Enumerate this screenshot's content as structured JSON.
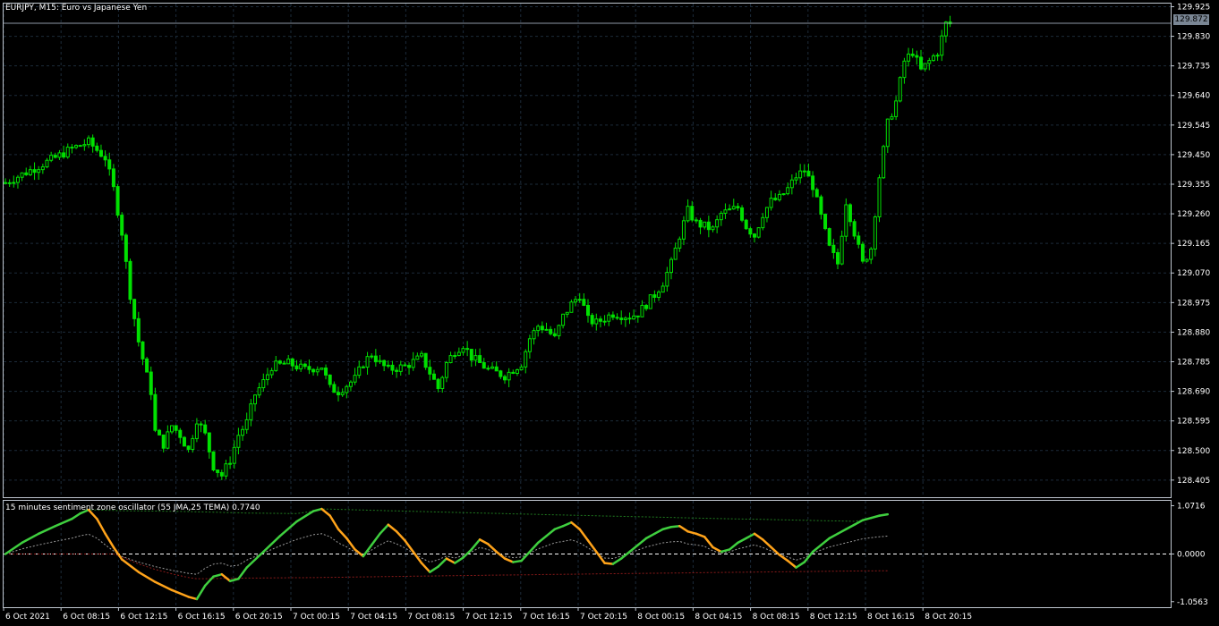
{
  "main_title": "EURJPY, M15:  Euro vs Japanese Yen",
  "osc_title": "15 minutes sentiment zone oscillator (55 JMA,25 TEMA) 0.7740",
  "current_price": "129.872",
  "colors": {
    "background": "#000000",
    "grid": "#1c2b3a",
    "candle": "#00e000",
    "osc_up": "#3fcf3f",
    "osc_down": "#ffa31a",
    "zone_top": "#1f7a1f",
    "zone_bottom": "#8b1a1a",
    "mid_gray": "#9a9a9a"
  },
  "chart_data": [
    {
      "type": "candlestick",
      "title": "EURJPY, M15:  Euro vs Japanese Yen",
      "x_ticks": [
        "6 Oct 2021",
        "6 Oct 08:15",
        "6 Oct 12:15",
        "6 Oct 16:15",
        "6 Oct 20:15",
        "7 Oct 00:15",
        "7 Oct 04:15",
        "7 Oct 08:15",
        "7 Oct 12:15",
        "7 Oct 16:15",
        "7 Oct 20:15",
        "8 Oct 00:15",
        "8 Oct 04:15",
        "8 Oct 08:15",
        "8 Oct 12:15",
        "8 Oct 16:15",
        "8 Oct 20:15"
      ],
      "y_ticks": [
        "129.925",
        "129.830",
        "129.735",
        "129.640",
        "129.545",
        "129.450",
        "129.355",
        "129.260",
        "129.165",
        "129.070",
        "128.975",
        "128.880",
        "128.785",
        "128.690",
        "128.595",
        "128.500",
        "128.405"
      ],
      "ylim": [
        128.35,
        129.935
      ],
      "current_price": 129.872,
      "close_path": [
        [
          0,
          129.36
        ],
        [
          6,
          129.4
        ],
        [
          12,
          129.44
        ],
        [
          16,
          129.47
        ],
        [
          20,
          129.49
        ],
        [
          24,
          129.44
        ],
        [
          26,
          129.34
        ],
        [
          28,
          129.2
        ],
        [
          30,
          129.0
        ],
        [
          32,
          128.85
        ],
        [
          34,
          128.74
        ],
        [
          35,
          128.69
        ],
        [
          36,
          128.56
        ],
        [
          38,
          128.52
        ],
        [
          40,
          128.58
        ],
        [
          42,
          128.55
        ],
        [
          44,
          128.5
        ],
        [
          46,
          128.6
        ],
        [
          48,
          128.55
        ],
        [
          50,
          128.45
        ],
        [
          52,
          128.42
        ],
        [
          54,
          128.47
        ],
        [
          56,
          128.55
        ],
        [
          58,
          128.59
        ],
        [
          60,
          128.68
        ],
        [
          62,
          128.72
        ],
        [
          64,
          128.77
        ],
        [
          68,
          128.78
        ],
        [
          72,
          128.76
        ],
        [
          76,
          128.77
        ],
        [
          78,
          128.7
        ],
        [
          80,
          128.69
        ],
        [
          84,
          128.73
        ],
        [
          86,
          128.78
        ],
        [
          88,
          128.81
        ],
        [
          90,
          128.78
        ],
        [
          92,
          128.76
        ],
        [
          96,
          128.77
        ],
        [
          100,
          128.8
        ],
        [
          102,
          128.75
        ],
        [
          104,
          128.7
        ],
        [
          106,
          128.78
        ],
        [
          108,
          128.82
        ],
        [
          110,
          128.84
        ],
        [
          112,
          128.8
        ],
        [
          116,
          128.76
        ],
        [
          120,
          128.74
        ],
        [
          124,
          128.78
        ],
        [
          126,
          128.86
        ],
        [
          128,
          128.9
        ],
        [
          130,
          128.89
        ],
        [
          132,
          128.86
        ],
        [
          134,
          128.93
        ],
        [
          136,
          128.97
        ],
        [
          138,
          129.0
        ],
        [
          140,
          128.92
        ],
        [
          142,
          128.91
        ],
        [
          146,
          128.94
        ],
        [
          150,
          128.93
        ],
        [
          152,
          128.94
        ],
        [
          156,
          129.0
        ],
        [
          158,
          129.04
        ],
        [
          160,
          129.1
        ],
        [
          162,
          129.19
        ],
        [
          164,
          129.27
        ],
        [
          166,
          129.23
        ],
        [
          168,
          129.22
        ],
        [
          170,
          129.21
        ],
        [
          172,
          129.26
        ],
        [
          176,
          129.28
        ],
        [
          178,
          129.22
        ],
        [
          180,
          129.19
        ],
        [
          182,
          129.26
        ],
        [
          184,
          129.3
        ],
        [
          186,
          129.31
        ],
        [
          188,
          129.34
        ],
        [
          190,
          129.38
        ],
        [
          192,
          129.4
        ],
        [
          194,
          129.35
        ],
        [
          196,
          129.25
        ],
        [
          198,
          129.15
        ],
        [
          200,
          129.1
        ],
        [
          202,
          129.3
        ],
        [
          204,
          129.2
        ],
        [
          206,
          129.1
        ],
        [
          208,
          129.15
        ],
        [
          210,
          129.38
        ],
        [
          212,
          129.55
        ],
        [
          214,
          129.62
        ],
        [
          216,
          129.75
        ],
        [
          218,
          129.78
        ],
        [
          220,
          129.72
        ],
        [
          222,
          129.75
        ],
        [
          224,
          129.78
        ],
        [
          226,
          129.87
        ],
        [
          227,
          129.87
        ]
      ]
    },
    {
      "type": "line",
      "title": "15 minutes sentiment zone oscillator (55 JMA,25 TEMA) 0.7740",
      "y_ticks": [
        "1.0716",
        "0.0000",
        "-1.0563"
      ],
      "ylim": [
        -1.18,
        1.18
      ],
      "level_line": 0.0,
      "series": [
        {
          "values": [
            [
              0,
              0.0
            ],
            [
              4,
              0.25
            ],
            [
              8,
              0.45
            ],
            [
              12,
              0.62
            ],
            [
              16,
              0.78
            ],
            [
              18,
              0.9
            ],
            [
              20,
              0.98
            ],
            [
              22,
              0.78
            ],
            [
              24,
              0.45
            ],
            [
              26,
              0.15
            ],
            [
              28,
              -0.12
            ],
            [
              32,
              -0.4
            ],
            [
              36,
              -0.62
            ],
            [
              40,
              -0.8
            ],
            [
              44,
              -0.95
            ],
            [
              46,
              -1.0
            ],
            [
              48,
              -0.7
            ],
            [
              50,
              -0.5
            ],
            [
              52,
              -0.45
            ],
            [
              54,
              -0.6
            ],
            [
              56,
              -0.55
            ],
            [
              58,
              -0.3
            ],
            [
              62,
              0.05
            ],
            [
              66,
              0.4
            ],
            [
              70,
              0.72
            ],
            [
              74,
              0.95
            ],
            [
              76,
              1.0
            ],
            [
              78,
              0.85
            ],
            [
              80,
              0.55
            ],
            [
              82,
              0.35
            ],
            [
              84,
              0.1
            ],
            [
              86,
              -0.05
            ],
            [
              88,
              0.2
            ],
            [
              90,
              0.45
            ],
            [
              92,
              0.65
            ],
            [
              94,
              0.5
            ],
            [
              96,
              0.3
            ],
            [
              98,
              0.05
            ],
            [
              100,
              -0.2
            ],
            [
              102,
              -0.4
            ],
            [
              104,
              -0.28
            ],
            [
              106,
              -0.1
            ],
            [
              108,
              -0.2
            ],
            [
              110,
              -0.08
            ],
            [
              112,
              0.1
            ],
            [
              114,
              0.32
            ],
            [
              116,
              0.22
            ],
            [
              118,
              0.05
            ],
            [
              120,
              -0.1
            ],
            [
              122,
              -0.18
            ],
            [
              124,
              -0.15
            ],
            [
              126,
              0.05
            ],
            [
              128,
              0.25
            ],
            [
              130,
              0.4
            ],
            [
              132,
              0.55
            ],
            [
              134,
              0.62
            ],
            [
              136,
              0.7
            ],
            [
              138,
              0.55
            ],
            [
              140,
              0.3
            ],
            [
              142,
              0.05
            ],
            [
              144,
              -0.2
            ],
            [
              146,
              -0.22
            ],
            [
              148,
              -0.1
            ],
            [
              150,
              0.05
            ],
            [
              152,
              0.2
            ],
            [
              154,
              0.35
            ],
            [
              156,
              0.45
            ],
            [
              158,
              0.55
            ],
            [
              160,
              0.6
            ],
            [
              162,
              0.62
            ],
            [
              164,
              0.5
            ],
            [
              166,
              0.45
            ],
            [
              168,
              0.38
            ],
            [
              170,
              0.15
            ],
            [
              172,
              0.05
            ],
            [
              174,
              0.1
            ],
            [
              176,
              0.25
            ],
            [
              178,
              0.35
            ],
            [
              180,
              0.45
            ],
            [
              182,
              0.32
            ],
            [
              184,
              0.15
            ],
            [
              186,
              -0.02
            ],
            [
              188,
              -0.15
            ],
            [
              190,
              -0.3
            ],
            [
              192,
              -0.18
            ],
            [
              194,
              0.05
            ],
            [
              196,
              0.2
            ],
            [
              198,
              0.35
            ],
            [
              200,
              0.45
            ],
            [
              202,
              0.55
            ],
            [
              204,
              0.65
            ],
            [
              206,
              0.75
            ],
            [
              208,
              0.8
            ],
            [
              210,
              0.85
            ],
            [
              212,
              0.88
            ]
          ]
        }
      ]
    }
  ]
}
